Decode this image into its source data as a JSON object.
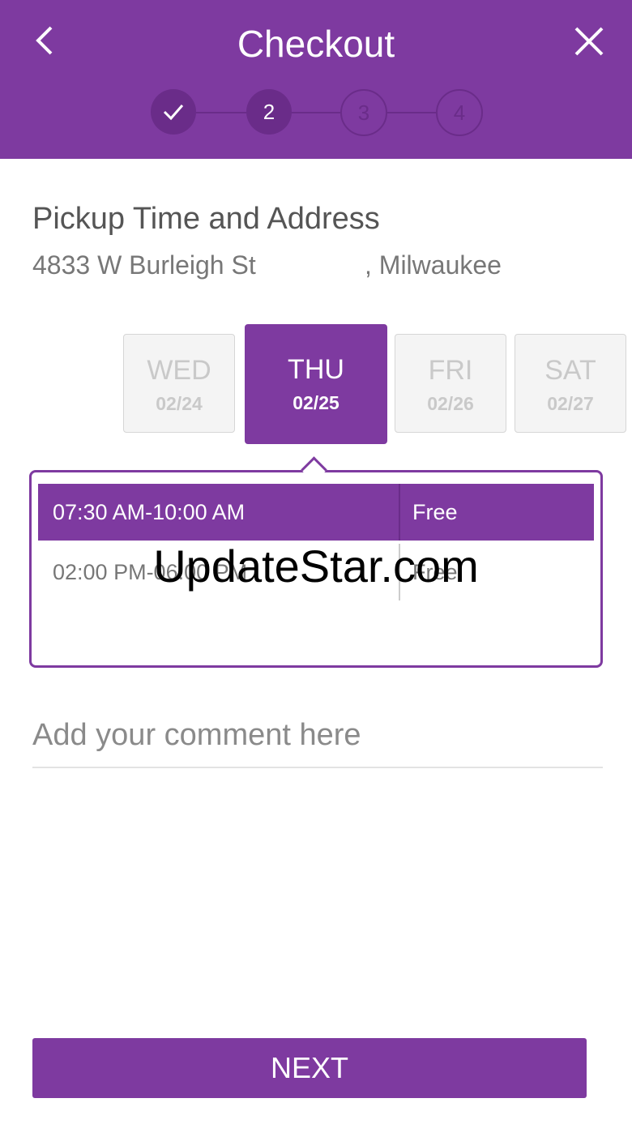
{
  "header": {
    "title": "Checkout",
    "back_icon": "chevron-left-icon",
    "close_icon": "close-icon",
    "steps": [
      {
        "label": "",
        "state": "done",
        "icon": "check-icon"
      },
      {
        "label": "2",
        "state": "current"
      },
      {
        "label": "3",
        "state": "upcoming"
      },
      {
        "label": "4",
        "state": "upcoming"
      }
    ]
  },
  "pickup": {
    "heading": "Pickup Time and Address",
    "street": "4833 W Burleigh St",
    "city": ", Milwaukee"
  },
  "days": [
    {
      "day": "WED",
      "date": "02/24",
      "selected": false
    },
    {
      "day": "THU",
      "date": "02/25",
      "selected": true
    },
    {
      "day": "FRI",
      "date": "02/26",
      "selected": false
    },
    {
      "day": "SAT",
      "date": "02/27",
      "selected": false
    }
  ],
  "time_slots": [
    {
      "time": "07:30 AM-10:00 AM",
      "price": "Free",
      "selected": true
    },
    {
      "time": "02:00 PM-06:00 PM",
      "price": "Free",
      "selected": false
    }
  ],
  "comment": {
    "placeholder": "Add your comment here",
    "value": ""
  },
  "next_label": "NEXT",
  "watermark": "UpdateStar.com",
  "colors": {
    "accent": "#7e3aa0",
    "accent_dark": "#6a2c89"
  }
}
